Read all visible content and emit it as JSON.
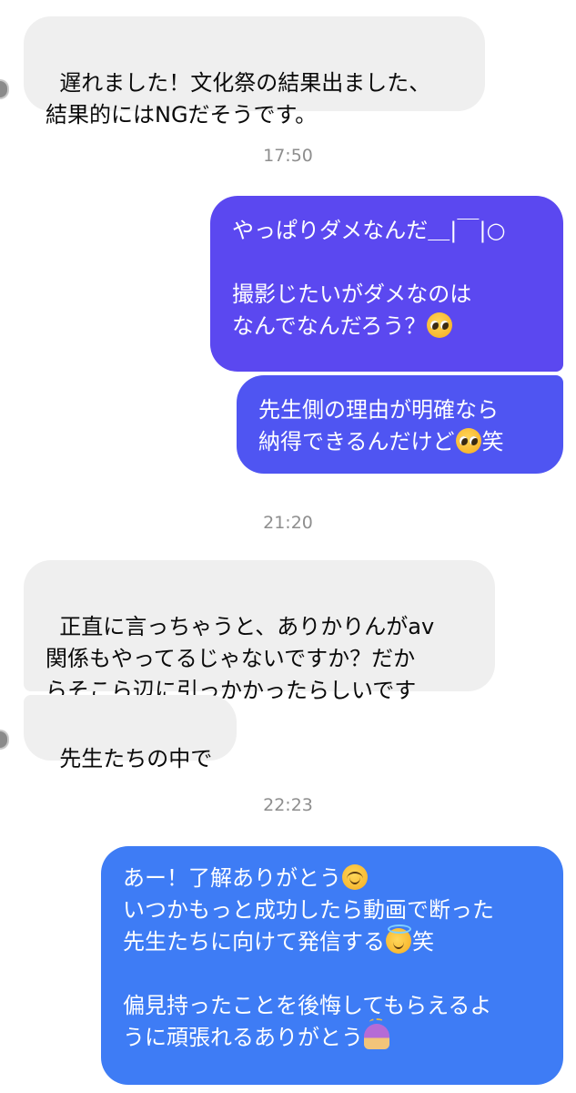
{
  "messages": [
    {
      "id": "m1",
      "direction": "received",
      "text": "遅れました！文化祭の結果出ました、\n結果的にはNGだそうです。"
    },
    {
      "id": "t1",
      "timestamp": "17:50"
    },
    {
      "id": "m2",
      "direction": "sent",
      "text": "やっぱりダメなんだ＿|￣|○\n\n撮影じたいがダメなのは\nなんでなんだろう？",
      "emoji": "pleading-face"
    },
    {
      "id": "m3",
      "direction": "sent",
      "text_a": "先生側の理由が明確なら\n納得できるんだけど",
      "text_b": "笑",
      "emoji": "pleading-face"
    },
    {
      "id": "t2",
      "timestamp": "21:20"
    },
    {
      "id": "m4",
      "direction": "received",
      "text": "正直に言っちゃうと、ありかりんがav\n関係もやってるじゃないですか？だか\nらそこら辺に引っかかったらしいです"
    },
    {
      "id": "m5",
      "direction": "received",
      "text": "先生たちの中で"
    },
    {
      "id": "t3",
      "timestamp": "22:23"
    },
    {
      "id": "m6",
      "direction": "sent",
      "line1": "あー！了解ありがとう",
      "line1_emoji": "smiling-face",
      "line2": "いつかもっと成功したら動画で断った",
      "line3": "先生たちに向けて発信する",
      "line3_emoji": "halo-face",
      "line3_tail": "笑",
      "line4": "偏見持ったことを後悔してもらえるよ",
      "line5": "うに頑張れるありがとう",
      "line5_emoji": "bowing-person"
    }
  ],
  "colors": {
    "received_bubble": "#efefef",
    "sent_purple": "#5b48f0",
    "sent_indigo": "#4f55f2",
    "sent_blue": "#3e7cf5",
    "timestamp": "#8e8e8e"
  }
}
